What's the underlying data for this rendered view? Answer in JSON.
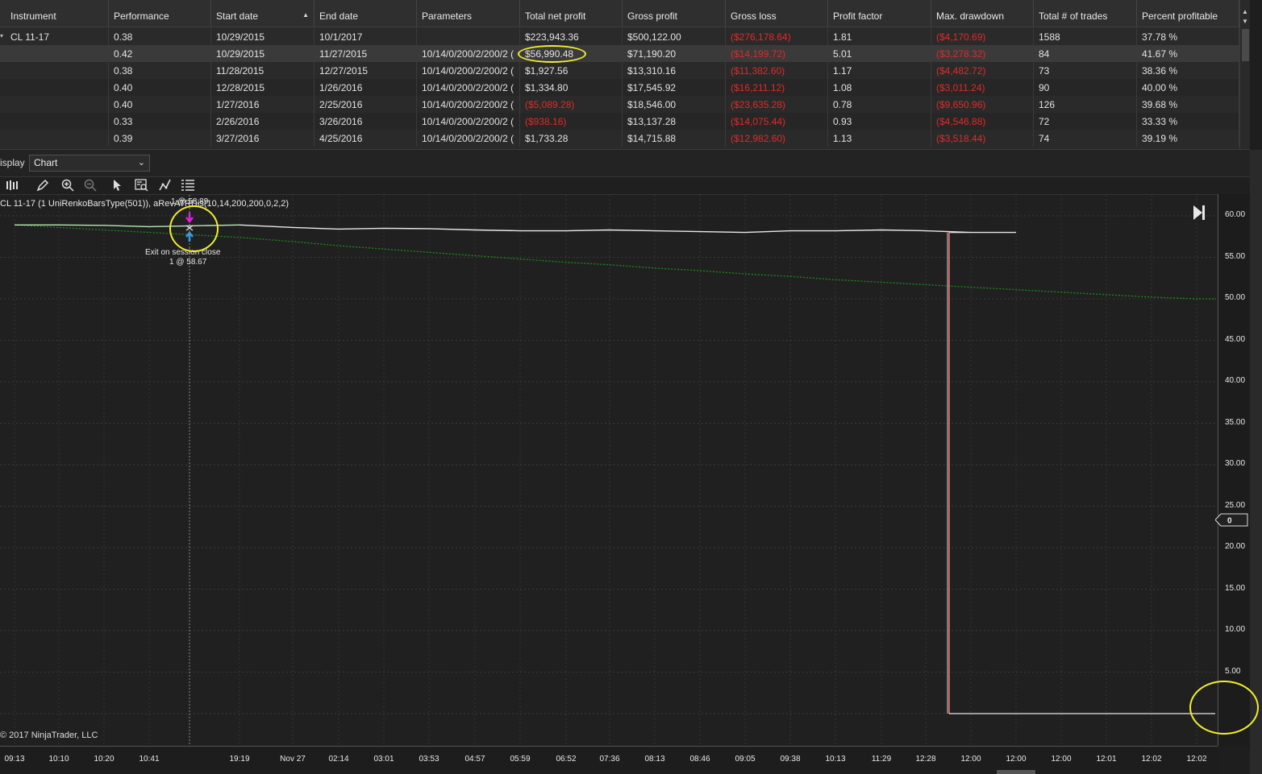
{
  "grid": {
    "columns": [
      {
        "label": "Instrument"
      },
      {
        "label": "Performance"
      },
      {
        "label": "Start date",
        "sorted": "asc"
      },
      {
        "label": "End date"
      },
      {
        "label": "Parameters"
      },
      {
        "label": "Total net profit"
      },
      {
        "label": "Gross profit"
      },
      {
        "label": "Gross loss"
      },
      {
        "label": "Profit factor"
      },
      {
        "label": "Max. drawdown"
      },
      {
        "label": "Total # of trades"
      },
      {
        "label": "Percent profitable"
      }
    ],
    "rows": [
      {
        "instrument": "CL 11-17",
        "performance": "0.38",
        "start": "10/29/2015",
        "end": "10/1/2017",
        "params": "",
        "net": "$223,943.36",
        "net_neg": false,
        "gross_profit": "$500,122.00",
        "gross_loss": "($276,178.64)",
        "pf": "1.81",
        "dd": "($4,170.69)",
        "trades": "1588",
        "pct": "37.78 %"
      },
      {
        "instrument": "",
        "performance": "0.42",
        "start": "10/29/2015",
        "end": "11/27/2015",
        "params": "10/14/0/200/2/200/2 (",
        "net": "$56,990.48",
        "net_neg": false,
        "gross_profit": "$71,190.20",
        "gross_loss": "($14,199.72)",
        "pf": "5.01",
        "dd": "($3,278.32)",
        "trades": "84",
        "pct": "41.67 %"
      },
      {
        "instrument": "",
        "performance": "0.38",
        "start": "11/28/2015",
        "end": "12/27/2015",
        "params": "10/14/0/200/2/200/2 (",
        "net": "$1,927.56",
        "net_neg": false,
        "gross_profit": "$13,310.16",
        "gross_loss": "($11,382.60)",
        "pf": "1.17",
        "dd": "($4,482.72)",
        "trades": "73",
        "pct": "38.36 %"
      },
      {
        "instrument": "",
        "performance": "0.40",
        "start": "12/28/2015",
        "end": "1/26/2016",
        "params": "10/14/0/200/2/200/2 (",
        "net": "$1,334.80",
        "net_neg": false,
        "gross_profit": "$17,545.92",
        "gross_loss": "($16,211.12)",
        "pf": "1.08",
        "dd": "($3,011.24)",
        "trades": "90",
        "pct": "40.00 %"
      },
      {
        "instrument": "",
        "performance": "0.40",
        "start": "1/27/2016",
        "end": "2/25/2016",
        "params": "10/14/0/200/2/200/2 (",
        "net": "($5,089.28)",
        "net_neg": true,
        "gross_profit": "$18,546.00",
        "gross_loss": "($23,635.28)",
        "pf": "0.78",
        "dd": "($9,650.96)",
        "trades": "126",
        "pct": "39.68 %"
      },
      {
        "instrument": "",
        "performance": "0.33",
        "start": "2/26/2016",
        "end": "3/26/2016",
        "params": "10/14/0/200/2/200/2 (",
        "net": "($938.16)",
        "net_neg": true,
        "gross_profit": "$13,137.28",
        "gross_loss": "($14,075.44)",
        "pf": "0.93",
        "dd": "($4,546.88)",
        "trades": "72",
        "pct": "33.33 %"
      },
      {
        "instrument": "",
        "performance": "0.39",
        "start": "3/27/2016",
        "end": "4/25/2016",
        "params": "10/14/0/200/2/200/2 (",
        "net": "$1,733.28",
        "net_neg": false,
        "gross_profit": "$14,715.88",
        "gross_loss": "($12,982.60)",
        "pf": "1.13",
        "dd": "($3,518.44)",
        "trades": "74",
        "pct": "39.19 %"
      }
    ]
  },
  "display": {
    "label": "isplay",
    "selected": "Chart"
  },
  "toolbar": {
    "icons": [
      "bars-icon",
      "pencil-icon",
      "zoom-in-icon",
      "zoom-out-icon",
      "pointer-icon",
      "data-box-icon",
      "indicator-icon",
      "properties-icon"
    ]
  },
  "chart": {
    "instrument_label": "CL 11-17 (1 UniRenkoBarsType(501)), aRevATRDis(10,14,200,200,0,2,2)",
    "entry_annotation": "1 @ 58.89",
    "exit_annotation_line1": "Exit on session close",
    "exit_annotation_line2": "1 @ 58.67",
    "copyright": "© 2017 NinjaTrader, LLC",
    "price_marker": "0",
    "colors": {
      "price": "#e8e8e8",
      "trend": "#1f8a1f",
      "drop": "#ff8080",
      "highlight": "#f1ee2e",
      "negative": "#e02a2a",
      "entry_arrow": "#e020e0",
      "exit_arrow": "#3a9ae0"
    }
  },
  "chart_data": {
    "type": "line",
    "ylim": [
      0,
      60
    ],
    "y_ticks": [
      "60.00",
      "55.00",
      "50.00",
      "45.00",
      "40.00",
      "35.00",
      "30.00",
      "25.00",
      "20.00",
      "15.00",
      "10.00",
      "5.00"
    ],
    "x_ticks": [
      "09:13",
      "10:10",
      "10:20",
      "10:41",
      "19:19",
      "Nov 27",
      "02:14",
      "03:01",
      "03:53",
      "04:57",
      "05:59",
      "06:52",
      "07:36",
      "08:13",
      "08:46",
      "09:05",
      "09:38",
      "10:13",
      "11:29",
      "12:28",
      "12:00",
      "12:00",
      "12:00",
      "12:01",
      "12:02",
      "12:02"
    ],
    "series": [
      {
        "values": [
          58.9,
          58.9,
          58.85,
          58.7,
          58.9,
          58.6,
          58.4,
          58.5,
          58.45,
          58.3,
          58.2,
          58.2,
          58.3,
          58.2,
          58.1,
          58.0,
          58.2,
          58.2,
          58.3,
          58.2,
          58.0,
          58.0,
          0,
          0,
          0,
          0
        ]
      },
      {
        "values": [
          58.9,
          58.6,
          58.3,
          58.0,
          57.4,
          56.9,
          56.4,
          56.0,
          55.6,
          55.2,
          54.8,
          54.4,
          54.1,
          53.7,
          53.4,
          53.0,
          52.7,
          52.3,
          52.0,
          51.7,
          51.4,
          51.1,
          50.8,
          50.5,
          50.2,
          50.0
        ]
      }
    ]
  }
}
